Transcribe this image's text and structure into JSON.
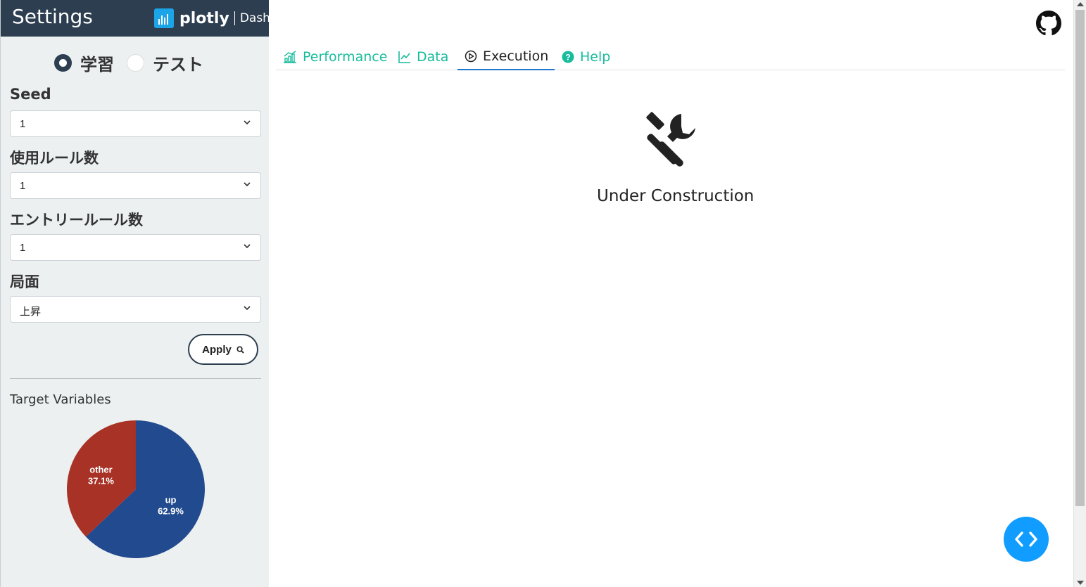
{
  "sidebar": {
    "title": "Settings",
    "logo": {
      "brand": "plotly",
      "product": "Dash"
    },
    "mode_options": [
      {
        "label": "学習",
        "checked": true
      },
      {
        "label": "テスト",
        "checked": false
      }
    ],
    "fields": [
      {
        "label": "Seed",
        "value": "1"
      },
      {
        "label": "使用ルール数",
        "value": "1"
      },
      {
        "label": "エントリールール数",
        "value": "1"
      },
      {
        "label": "局面",
        "value": "上昇"
      }
    ],
    "apply_label": "Apply",
    "target_variables_title": "Target Variables"
  },
  "chart_data": {
    "type": "pie",
    "title": "",
    "slices": [
      {
        "label": "up",
        "percent": 62.9,
        "percent_text": "62.9%",
        "color": "#224a8e"
      },
      {
        "label": "other",
        "percent": 37.1,
        "percent_text": "37.1%",
        "color": "#a83226"
      }
    ]
  },
  "main": {
    "tabs": [
      {
        "label": "Performance",
        "icon": "chart-bar-icon",
        "active": false
      },
      {
        "label": "Data",
        "icon": "chart-line-icon",
        "active": false
      },
      {
        "label": "Execution",
        "icon": "play-circle-icon",
        "active": true
      },
      {
        "label": "Help",
        "icon": "question-circle-icon",
        "active": false
      }
    ],
    "content_icon": "tools-icon",
    "content_text": "Under Construction"
  },
  "colors": {
    "header": "#2c3e50",
    "accent": "#18bc9c",
    "tab_active_underline": "#1f77d0",
    "fab": "#119dff"
  }
}
